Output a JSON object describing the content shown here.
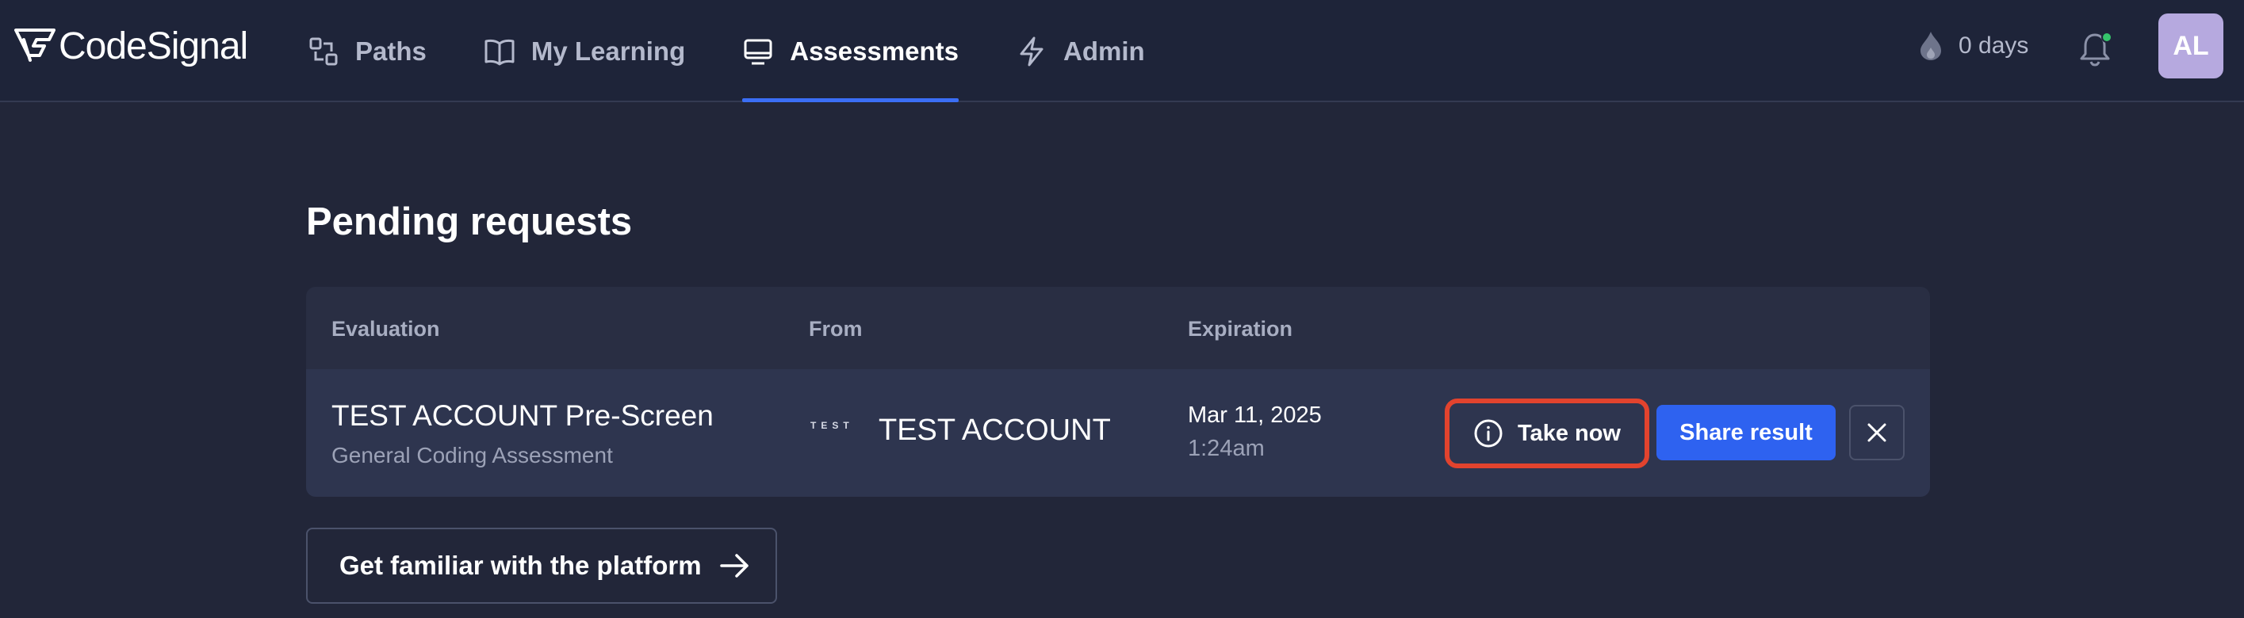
{
  "app": {
    "logo_text": "CodeSignal"
  },
  "nav": {
    "items": [
      {
        "label": "Paths",
        "icon": "paths-icon",
        "active": false
      },
      {
        "label": "My Learning",
        "icon": "book-icon",
        "active": false
      },
      {
        "label": "Assessments",
        "icon": "monitor-icon",
        "active": true
      },
      {
        "label": "Admin",
        "icon": "lightning-icon",
        "active": false
      }
    ]
  },
  "header": {
    "streak_label": "0 days",
    "avatar_initials": "AL",
    "notification_indicator_color": "#35c46b"
  },
  "main": {
    "title": "Pending requests",
    "table": {
      "columns": [
        "Evaluation",
        "From",
        "Expiration"
      ],
      "rows": [
        {
          "evaluation_title": "TEST ACCOUNT Pre-Screen",
          "evaluation_subtitle": "General Coding Assessment",
          "from_logo_text": "TEST",
          "from_name": "TEST ACCOUNT",
          "expiration_date": "Mar 11, 2025",
          "expiration_time": "1:24am",
          "take_now_label": "Take now",
          "share_result_label": "Share result"
        }
      ]
    },
    "familiar_button_label": "Get familiar with the platform"
  },
  "colors": {
    "background": "#222639",
    "topbar": "#1e2439",
    "accent": "#2e62f0",
    "highlight": "#e2432e",
    "avatar": "#b6a9df"
  }
}
